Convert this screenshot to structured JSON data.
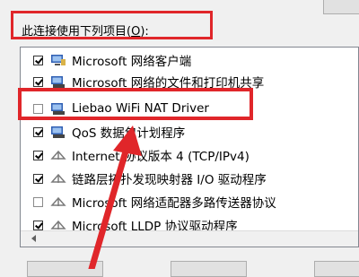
{
  "dialog": {
    "section_label_prefix": "此连接使用下列项目(",
    "section_label_hotkey": "O",
    "section_label_suffix": "):"
  },
  "items": [
    {
      "label": "Microsoft 网络客户端",
      "checked": true,
      "icon": "network-client-icon"
    },
    {
      "label": "Microsoft 网络的文件和打印机共享",
      "checked": true,
      "icon": "file-printer-sharing-icon"
    },
    {
      "label": "Liebao WiFi NAT Driver",
      "checked": false,
      "icon": "network-driver-icon"
    },
    {
      "label": "QoS 数据包计划程序",
      "checked": true,
      "icon": "qos-scheduler-icon"
    },
    {
      "label": "Internet 协议版本 4 (TCP/IPv4)",
      "checked": true,
      "icon": "protocol-icon"
    },
    {
      "label": "链路层拓扑发现映射器 I/O 驱动程序",
      "checked": true,
      "icon": "protocol-icon"
    },
    {
      "label": "Microsoft 网络适配器多路传送器协议",
      "checked": false,
      "icon": "protocol-icon"
    },
    {
      "label": "Microsoft LLDP 协议驱动程序",
      "checked": true,
      "icon": "protocol-icon"
    }
  ],
  "colors": {
    "highlight": "#e0262a"
  }
}
